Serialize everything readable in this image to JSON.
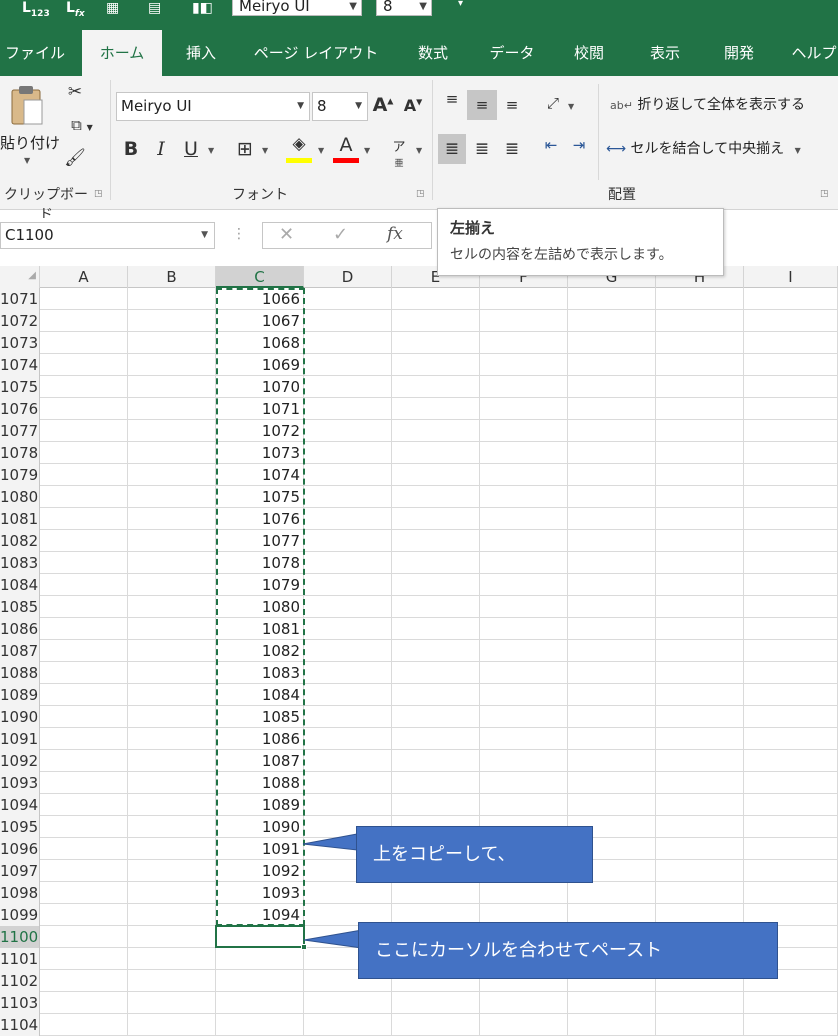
{
  "quick_access": {
    "icons": [
      "paste-values-icon",
      "paste-formulas-icon",
      "format-number-icon",
      "table-icon",
      "insert-icon"
    ],
    "font_name": "Meiryo UI",
    "font_size": "8"
  },
  "tabs": [
    "ファイル",
    "ホーム",
    "挿入",
    "ページ レイアウト",
    "数式",
    "データ",
    "校閲",
    "表示",
    "開発",
    "ヘルプ"
  ],
  "active_tab": "ホーム",
  "ribbon": {
    "clipboard": {
      "paste_label": "貼り付け",
      "group_label": "クリップボード"
    },
    "font": {
      "font_name": "Meiryo UI",
      "font_size": "8",
      "grow": "A",
      "shrink": "A",
      "bold": "B",
      "italic": "I",
      "underline": "U",
      "group_label": "フォント",
      "fill_color": "#ffff00",
      "font_color": "#ff0000"
    },
    "alignment": {
      "wrap_text": "折り返して全体を表示する",
      "merge_center": "セルを結合して中央揃え",
      "group_label": "配置"
    }
  },
  "formula_bar": {
    "name_box": "C1100",
    "fx": "fx"
  },
  "tooltip": {
    "title": "左揃え",
    "description": "セルの内容を左詰めで表示します。"
  },
  "columns": [
    "A",
    "B",
    "C",
    "D",
    "E",
    "F",
    "G",
    "H",
    "I"
  ],
  "rows": [
    {
      "num": "1071",
      "c": "1066"
    },
    {
      "num": "1072",
      "c": "1067"
    },
    {
      "num": "1073",
      "c": "1068"
    },
    {
      "num": "1074",
      "c": "1069"
    },
    {
      "num": "1075",
      "c": "1070"
    },
    {
      "num": "1076",
      "c": "1071"
    },
    {
      "num": "1077",
      "c": "1072"
    },
    {
      "num": "1078",
      "c": "1073"
    },
    {
      "num": "1079",
      "c": "1074"
    },
    {
      "num": "1080",
      "c": "1075"
    },
    {
      "num": "1081",
      "c": "1076"
    },
    {
      "num": "1082",
      "c": "1077"
    },
    {
      "num": "1083",
      "c": "1078"
    },
    {
      "num": "1084",
      "c": "1079"
    },
    {
      "num": "1085",
      "c": "1080"
    },
    {
      "num": "1086",
      "c": "1081"
    },
    {
      "num": "1087",
      "c": "1082"
    },
    {
      "num": "1088",
      "c": "1083"
    },
    {
      "num": "1089",
      "c": "1084"
    },
    {
      "num": "1090",
      "c": "1085"
    },
    {
      "num": "1091",
      "c": "1086"
    },
    {
      "num": "1092",
      "c": "1087"
    },
    {
      "num": "1093",
      "c": "1088"
    },
    {
      "num": "1094",
      "c": "1089"
    },
    {
      "num": "1095",
      "c": "1090"
    },
    {
      "num": "1096",
      "c": "1091"
    },
    {
      "num": "1097",
      "c": "1092"
    },
    {
      "num": "1098",
      "c": "1093"
    },
    {
      "num": "1099",
      "c": "1094"
    },
    {
      "num": "1100",
      "c": ""
    },
    {
      "num": "1101",
      "c": ""
    },
    {
      "num": "1102",
      "c": ""
    },
    {
      "num": "1103",
      "c": ""
    },
    {
      "num": "1104",
      "c": ""
    }
  ],
  "callouts": {
    "copy": "上をコピーして、",
    "paste": "ここにカーソルを合わせてペースト"
  },
  "colors": {
    "excel_green": "#217346",
    "callout_blue": "#4472c4",
    "selection_green": "#217346"
  }
}
